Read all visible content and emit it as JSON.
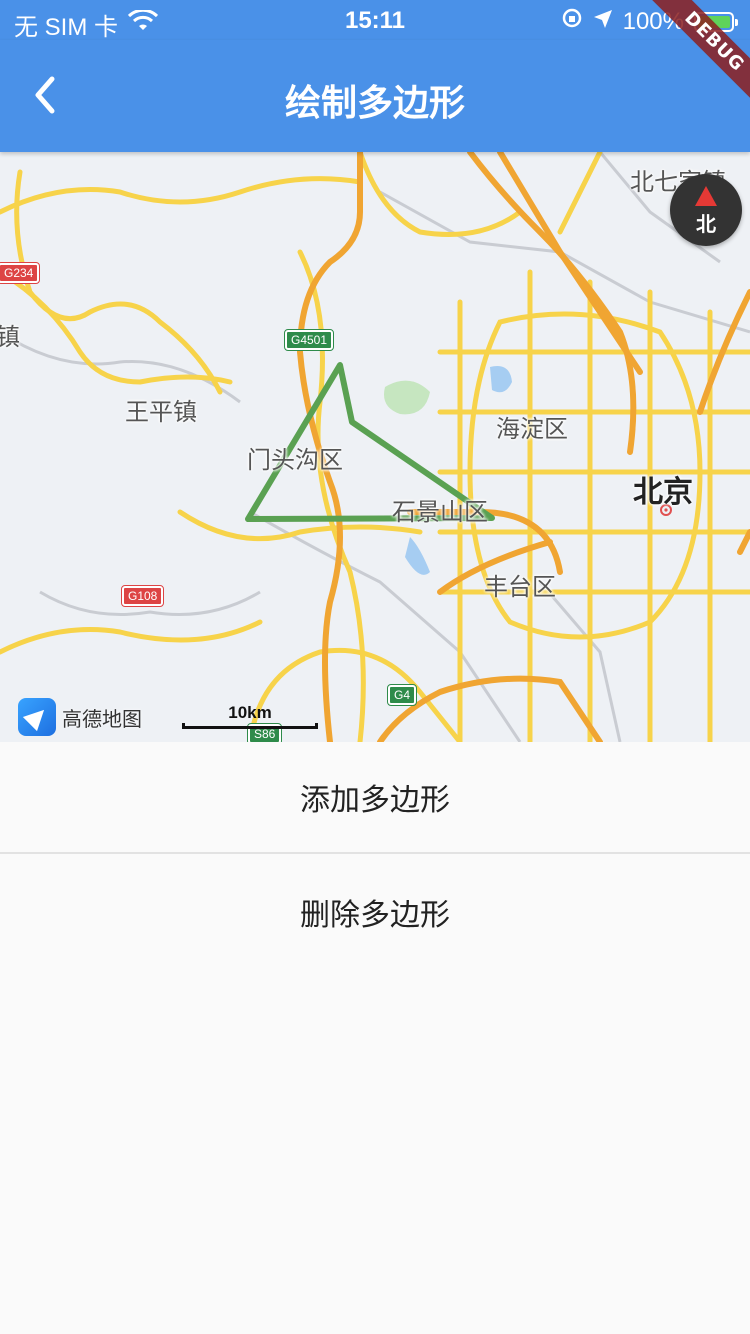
{
  "status_bar": {
    "carrier": "无 SIM 卡",
    "time": "15:11",
    "battery": "100%"
  },
  "app_bar": {
    "title": "绘制多边形"
  },
  "debug_banner": "DEBUG",
  "map": {
    "labels": {
      "north_qijia": "北七家镇",
      "wangping": "王平镇",
      "mentougou": "门头沟区",
      "haidian": "海淀区",
      "shijingshan": "石景山区",
      "beijing": "北京",
      "fengtai": "丰台区",
      "zhen_left": "镇"
    },
    "shields": {
      "g234": "G234",
      "g4501": "G4501",
      "g108": "G108",
      "g4": "G4",
      "s86": "S86"
    },
    "compass_label": "北",
    "logo_text": "高德地图",
    "scale_label": "10km",
    "polygon_color": "#5aa152"
  },
  "buttons": {
    "add": "添加多边形",
    "delete": "删除多边形"
  },
  "colors": {
    "app_bar": "#4a91e8",
    "background": "#fafafa"
  }
}
